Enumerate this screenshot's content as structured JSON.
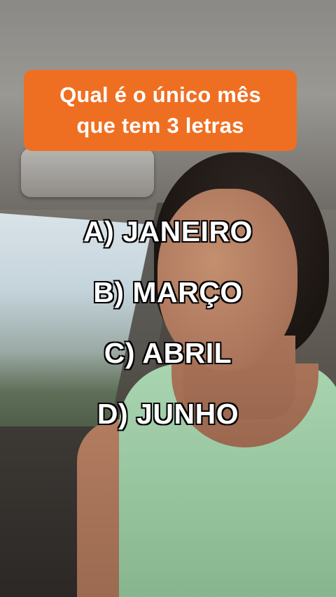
{
  "question": {
    "line1": "Qual é o único mês",
    "line2": "que tem 3 letras",
    "background_color": "#ef6f22"
  },
  "options": [
    {
      "label": "A) JANEIRO"
    },
    {
      "label": "B) MARÇO"
    },
    {
      "label": "C) ABRIL"
    },
    {
      "label": "D) JUNHO"
    }
  ]
}
